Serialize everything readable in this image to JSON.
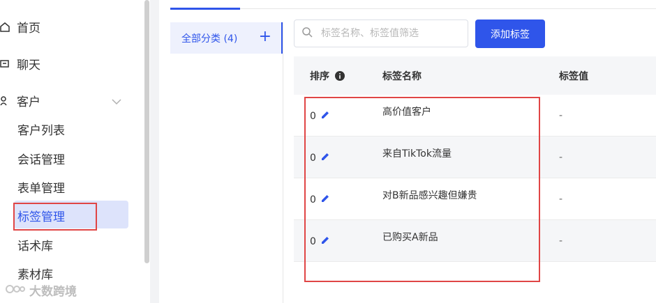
{
  "sidebar": {
    "nav": [
      {
        "label": "首页",
        "icon": "home-icon"
      },
      {
        "label": "聊天",
        "icon": "chat-icon"
      },
      {
        "label": "客户",
        "icon": "customer-icon"
      }
    ],
    "sub_items": [
      "客户列表",
      "会话管理",
      "表单管理",
      "标签管理",
      "话术库",
      "素材库"
    ],
    "active_sub": "标签管理",
    "watermark": "大数跨境"
  },
  "category": {
    "label": "全部分类 (4)",
    "add_icon": "plus-icon"
  },
  "search": {
    "placeholder": "标签名称、标签值筛选",
    "value": ""
  },
  "toolbar": {
    "add_label": "添加标签"
  },
  "table": {
    "headers": [
      "排序",
      "标签名称",
      "标签值"
    ],
    "rows": [
      {
        "sort": "0",
        "name": "高价值客户",
        "value": "-"
      },
      {
        "sort": "0",
        "name": "来自TikTok流量",
        "value": "-"
      },
      {
        "sort": "0",
        "name": "对B新品感兴趣但嫌贵",
        "value": "-"
      },
      {
        "sort": "0",
        "name": "已购买A新品",
        "value": "-"
      }
    ]
  },
  "colors": {
    "accent": "#2f55ea",
    "highlight": "#e04545",
    "active_bg": "#dde3fb"
  }
}
